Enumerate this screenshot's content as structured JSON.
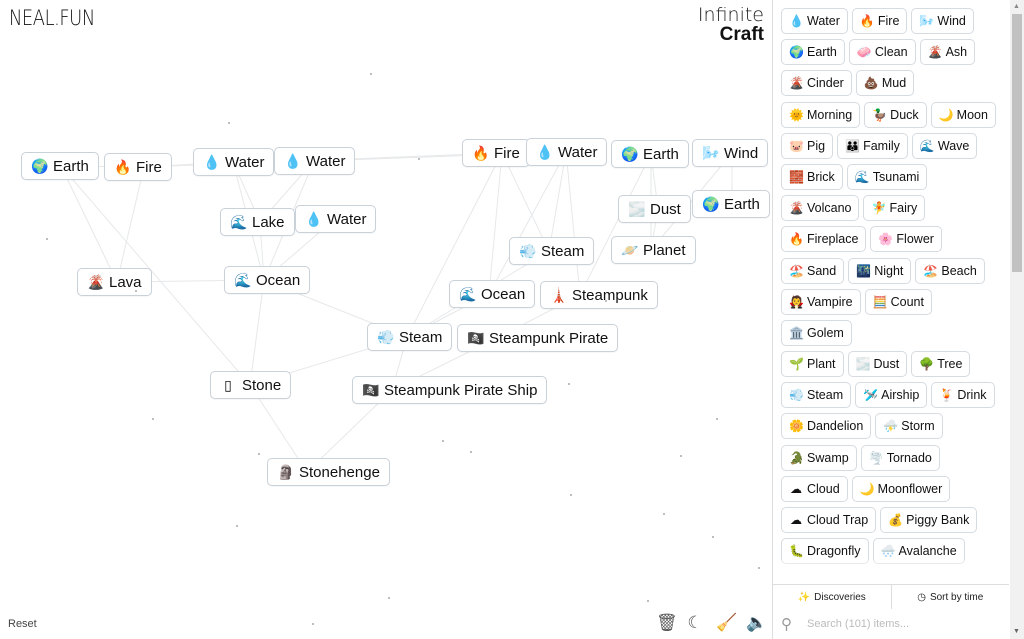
{
  "header": {
    "site_logo": "NEAL.FUN",
    "brand_line1": "Infinite",
    "brand_line2": "Craft"
  },
  "canvas": {
    "nodes": [
      {
        "label": "Earth",
        "icon": "🌍",
        "name": "earth"
      },
      {
        "label": "Fire",
        "icon": "🔥",
        "name": "fire"
      },
      {
        "label": "Water",
        "icon": "💧",
        "name": "water"
      },
      {
        "label": "Water",
        "icon": "💧",
        "name": "water"
      },
      {
        "label": "Lake",
        "icon": "🌊",
        "name": "lake"
      },
      {
        "label": "Water",
        "icon": "💧",
        "name": "water"
      },
      {
        "label": "Lava",
        "icon": "🌋",
        "name": "lava"
      },
      {
        "label": "Ocean",
        "icon": "🌊",
        "name": "ocean"
      },
      {
        "label": "Fire",
        "icon": "🔥",
        "name": "fire"
      },
      {
        "label": "Water",
        "icon": "💧",
        "name": "water"
      },
      {
        "label": "Earth",
        "icon": "🌍",
        "name": "earth"
      },
      {
        "label": "Wind",
        "icon": "🌬️",
        "name": "wind"
      },
      {
        "label": "Dust",
        "icon": "🌫️",
        "name": "dust"
      },
      {
        "label": "Earth",
        "icon": "🌍",
        "name": "earth"
      },
      {
        "label": "Steam",
        "icon": "💨",
        "name": "steam"
      },
      {
        "label": "Planet",
        "icon": "🪐",
        "name": "planet"
      },
      {
        "label": "Ocean",
        "icon": "🌊",
        "name": "ocean"
      },
      {
        "label": "Steampunk",
        "icon": "🗼",
        "name": "steampunk"
      },
      {
        "label": "Steam",
        "icon": "💨",
        "name": "steam"
      },
      {
        "label": "Steampunk Pirate",
        "icon": "🏴‍☠️",
        "name": "steampunk-pirate"
      },
      {
        "label": "Stone",
        "icon": "▯",
        "name": "stone"
      },
      {
        "label": "Steampunk Pirate Ship",
        "icon": "🏴‍☠️",
        "name": "steampunk-pirate-ship"
      },
      {
        "label": "Stonehenge",
        "icon": "🗿",
        "name": "stonehenge"
      }
    ],
    "reset_label": "Reset",
    "tools": [
      {
        "name": "trash-icon",
        "glyph": "🗑"
      },
      {
        "name": "dark-mode-icon",
        "glyph": "☾"
      },
      {
        "name": "broom-icon",
        "glyph": "🧹"
      },
      {
        "name": "sound-icon",
        "glyph": "🔈"
      }
    ]
  },
  "sidebar": {
    "items": [
      {
        "label": "Water",
        "icon": "💧"
      },
      {
        "label": "Fire",
        "icon": "🔥"
      },
      {
        "label": "Wind",
        "icon": "🌬️"
      },
      {
        "label": "Earth",
        "icon": "🌍"
      },
      {
        "label": "Clean",
        "icon": "🧼"
      },
      {
        "label": "Ash",
        "icon": "🌋"
      },
      {
        "label": "Cinder",
        "icon": "🌋"
      },
      {
        "label": "Mud",
        "icon": "💩"
      },
      {
        "label": "Morning",
        "icon": "🌞"
      },
      {
        "label": "Duck",
        "icon": "🦆"
      },
      {
        "label": "Moon",
        "icon": "🌙"
      },
      {
        "label": "Pig",
        "icon": "🐷"
      },
      {
        "label": "Family",
        "icon": "👪"
      },
      {
        "label": "Wave",
        "icon": "🌊"
      },
      {
        "label": "Brick",
        "icon": "🧱"
      },
      {
        "label": "Tsunami",
        "icon": "🌊"
      },
      {
        "label": "Volcano",
        "icon": "🌋"
      },
      {
        "label": "Fairy",
        "icon": "🧚"
      },
      {
        "label": "Fireplace",
        "icon": "🔥"
      },
      {
        "label": "Flower",
        "icon": "🌸"
      },
      {
        "label": "Sand",
        "icon": "🏖️"
      },
      {
        "label": "Night",
        "icon": "🌃"
      },
      {
        "label": "Beach",
        "icon": "🏖️"
      },
      {
        "label": "Vampire",
        "icon": "🧛"
      },
      {
        "label": "Count",
        "icon": "🧮"
      },
      {
        "label": "Golem",
        "icon": "🏛️"
      },
      {
        "label": "Plant",
        "icon": "🌱"
      },
      {
        "label": "Dust",
        "icon": "🌫️"
      },
      {
        "label": "Tree",
        "icon": "🌳"
      },
      {
        "label": "Steam",
        "icon": "💨"
      },
      {
        "label": "Airship",
        "icon": "🛩️"
      },
      {
        "label": "Drink",
        "icon": "🍹"
      },
      {
        "label": "Dandelion",
        "icon": "🌼"
      },
      {
        "label": "Storm",
        "icon": "⛈️"
      },
      {
        "label": "Swamp",
        "icon": "🐊"
      },
      {
        "label": "Tornado",
        "icon": "🌪️"
      },
      {
        "label": "Cloud",
        "icon": "☁"
      },
      {
        "label": "Moonflower",
        "icon": "🌙"
      },
      {
        "label": "Cloud Trap",
        "icon": "☁"
      },
      {
        "label": "Piggy Bank",
        "icon": "💰"
      },
      {
        "label": "Dragonfly",
        "icon": "🐛"
      },
      {
        "label": "Avalanche",
        "icon": "🌨️"
      }
    ],
    "discoveries_label": "Discoveries",
    "sort_label": "Sort by time",
    "search_placeholder": "Search (101) items..."
  }
}
